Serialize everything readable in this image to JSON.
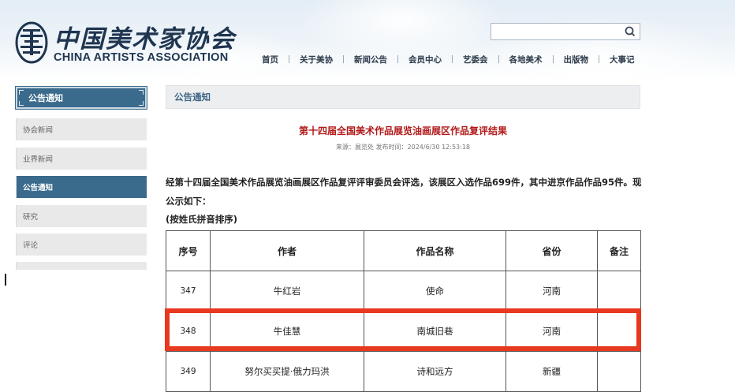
{
  "logo": {
    "cn": "中国美术家协会",
    "en": "CHINA ARTISTS ASSOCIATION"
  },
  "search": {
    "placeholder": ""
  },
  "nav": [
    "首页",
    "关于美协",
    "新闻公告",
    "会员中心",
    "艺委会",
    "各地美术",
    "出版物",
    "大事记"
  ],
  "sidebar": {
    "title": "公告通知",
    "items": [
      "协会新闻",
      "业界新闻",
      "公告通知",
      "研究",
      "评论",
      ""
    ],
    "active_index": 2
  },
  "content": {
    "heading": "公告通知",
    "title": "第十四届全国美术作品展览油画展区作品复评结果",
    "meta": "来源：展览处 发布时间：2024/6/30 12:53:18",
    "paragraph": "经第十四届全国美术作品展览油画展区作品复评评审委员会评选，该展区入选作品699件，其中进京作品作品95件。现公示如下：",
    "sort_note": "(按姓氏拼音排序)"
  },
  "table": {
    "headers": [
      "序号",
      "作者",
      "作品名称",
      "省份",
      "备注"
    ],
    "rows": [
      [
        "347",
        "牛红岩",
        "使命",
        "河南",
        ""
      ],
      [
        "348",
        "牛佳慧",
        "南城旧巷",
        "河南",
        ""
      ],
      [
        "349",
        "努尔买买提·俄力玛洪",
        "诗和远方",
        "新疆",
        ""
      ]
    ],
    "highlighted_row": 1
  },
  "colors": {
    "accent": "#3a6a8c",
    "title_red": "#b11a1a",
    "highlight": "#e8381f"
  }
}
